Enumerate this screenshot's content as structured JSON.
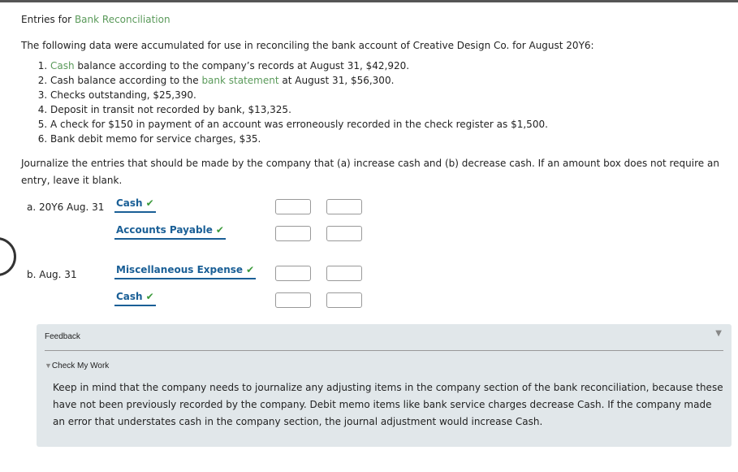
{
  "title": {
    "prefix": "Entries for ",
    "link": "Bank Reconciliation"
  },
  "intro": "The following data were accumulated for use in reconciling the bank account of Creative Design Co. for August 20Y6:",
  "items": [
    {
      "link": "Cash",
      "text": " balance according to the company’s records at August 31, $42,920."
    },
    {
      "pre": "Cash balance according to the ",
      "link": "bank statement",
      "text": " at August 31, $56,300."
    },
    {
      "text": "Checks outstanding, $25,390."
    },
    {
      "text": "Deposit in transit not recorded by bank, $13,325."
    },
    {
      "text": "A check for $150 in payment of an account was erroneously recorded in the check register as $1,500."
    },
    {
      "text": "Bank debit memo for service charges, $35."
    }
  ],
  "instructions_line1": "Journalize the entries that should be made by the company that (a) increase cash and (b) decrease cash. If an amount box does not require an",
  "instructions_line2": "entry, leave it blank.",
  "entries": {
    "a": {
      "label": "a. 20Y6 Aug. 31",
      "debit_account": "Cash",
      "credit_account": "Accounts Payable"
    },
    "b": {
      "label": "b. Aug. 31",
      "debit_account": "Miscellaneous Expense",
      "credit_account": "Cash"
    }
  },
  "check_icon": "✔",
  "feedback": {
    "title": "Feedback",
    "toggle": "▼",
    "check_my_work": "Check My Work",
    "text": "Keep in mind that the company needs to journalize any adjusting items in the company section of the bank reconciliation, because these have not been previously recorded by the company. Debit memo items like bank service charges decrease Cash. If the company made an error that understates cash in the company section, the journal adjustment would increase Cash."
  },
  "colors": {
    "link": "#5a9a5a",
    "account": "#1a5f96",
    "check": "#3a9a3a",
    "feedback_bg": "#e1e7ea"
  }
}
